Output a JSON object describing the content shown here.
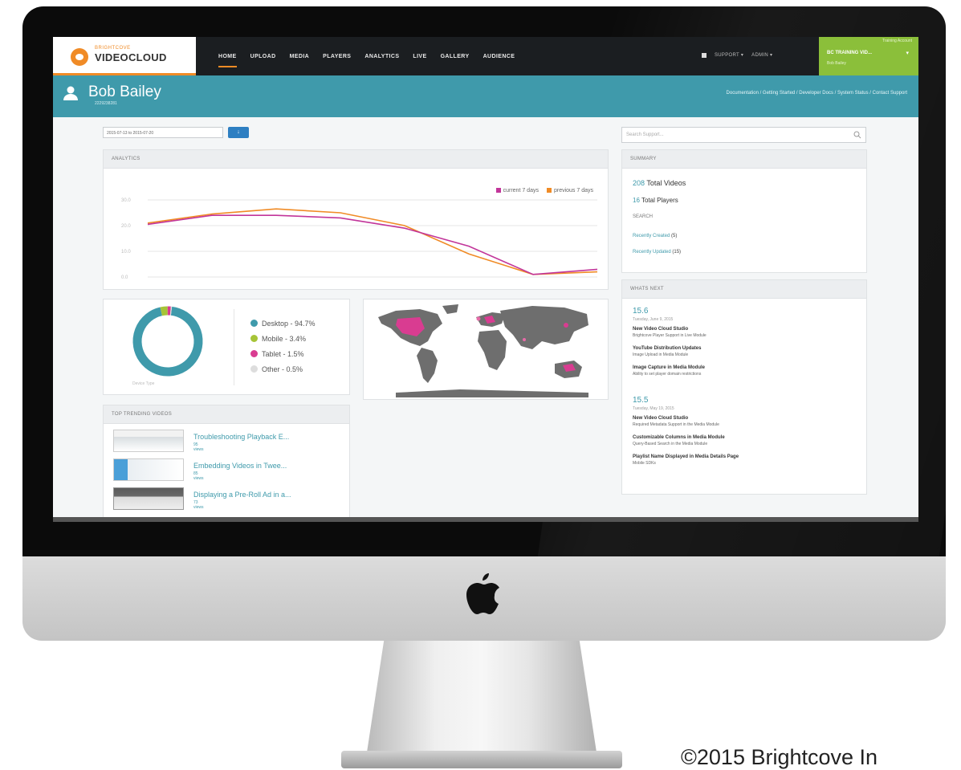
{
  "app": {
    "logo_sub": "BRIGHTCOVE",
    "logo_text": "VIDEOCLOUD",
    "nav": [
      "HOME",
      "UPLOAD",
      "MEDIA",
      "PLAYERS",
      "ANALYTICS",
      "LIVE",
      "GALLERY",
      "AUDIENCE"
    ],
    "support_label": "SUPPORT ▾",
    "admin_label": "ADMIN ▾",
    "account_top": "Training Account",
    "account_name": "BC TRAINING VID...",
    "account_user": "Bob Bailey"
  },
  "banner": {
    "user_name": "Bob Bailey",
    "user_id": "2229238281",
    "links": "Documentation / Getting Started / Developer Docs / System Status / Contact Support"
  },
  "filters": {
    "date_range": "2015-07-13 to 2015-07-20",
    "go_label": "↓"
  },
  "analytics": {
    "title": "ANALYTICS",
    "legend_current": "current 7 days",
    "legend_previous": "previous 7 days",
    "color_current": "#c2359a",
    "color_previous": "#f08b26"
  },
  "chart_data": {
    "type": "line",
    "title": "",
    "xlabel": "",
    "ylabel": "",
    "x": [
      1,
      2,
      3,
      4,
      5,
      6,
      7,
      8
    ],
    "y_ticks": [
      "30.0",
      "20.0",
      "10.0",
      "0.0"
    ],
    "ylim": [
      0,
      30
    ],
    "series": [
      {
        "name": "current 7 days",
        "values": [
          20.5,
          24,
          24,
          23,
          19,
          12,
          1,
          3
        ]
      },
      {
        "name": "previous 7 days",
        "values": [
          21,
          24.5,
          26.5,
          25,
          20,
          9,
          1,
          2
        ]
      }
    ]
  },
  "devices": {
    "items": [
      {
        "label": "Desktop - 94.7%",
        "value": 94.7,
        "color": "#3f9aab"
      },
      {
        "label": "Mobile - 3.4%",
        "value": 3.4,
        "color": "#a6c437"
      },
      {
        "label": "Tablet - 1.5%",
        "value": 1.5,
        "color": "#d93c91"
      },
      {
        "label": "Other - 0.5%",
        "value": 0.5,
        "color": "#dddddd"
      }
    ],
    "caption": "Device Type"
  },
  "trending": {
    "title": "TOP TRENDING VIDEOS",
    "items": [
      {
        "title": "Troubleshooting Playback E...",
        "views": "95 views"
      },
      {
        "title": "Embedding Videos in Twee...",
        "views": "85 views"
      },
      {
        "title": "Displaying a Pre-Roll Ad in a...",
        "views": "73 views"
      }
    ]
  },
  "search": {
    "placeholder": "Search Support..."
  },
  "summary": {
    "title": "SUMMARY",
    "videos_count": "208",
    "videos_label": "Total Videos",
    "players_count": "16",
    "players_label": "Total Players",
    "search_label": "SEARCH",
    "recent_created": "Recently Created",
    "recent_created_count": "(5)",
    "recent_updated": "Recently Updated",
    "recent_updated_count": "(15)"
  },
  "whats_next": {
    "title": "WHATS NEXT",
    "releases": [
      {
        "version": "15.6",
        "date": "Tuesday, June 9, 2015",
        "entries": [
          {
            "title": "New Video Cloud Studio",
            "sub": "Brightcove Player Support in Live Module"
          },
          {
            "title": "YouTube Distribution Updates",
            "sub": "Image Upload in Media Module"
          },
          {
            "title": "Image Capture in Media Module",
            "sub": "Ability to set player domain restrictions"
          }
        ]
      },
      {
        "version": "15.5",
        "date": "Tuesday, May 19, 2015",
        "entries": [
          {
            "title": "New Video Cloud Studio",
            "sub": "Required Metadata Support in the Media Module"
          },
          {
            "title": "Customizable Columns in Media Module",
            "sub": "Query-Based Search in the Media Module"
          },
          {
            "title": "Playlist Name Displayed in Media Details Page",
            "sub": "Mobile SDKs"
          }
        ]
      }
    ]
  },
  "footer": {
    "copyright": "©2015  Brightcove In"
  }
}
